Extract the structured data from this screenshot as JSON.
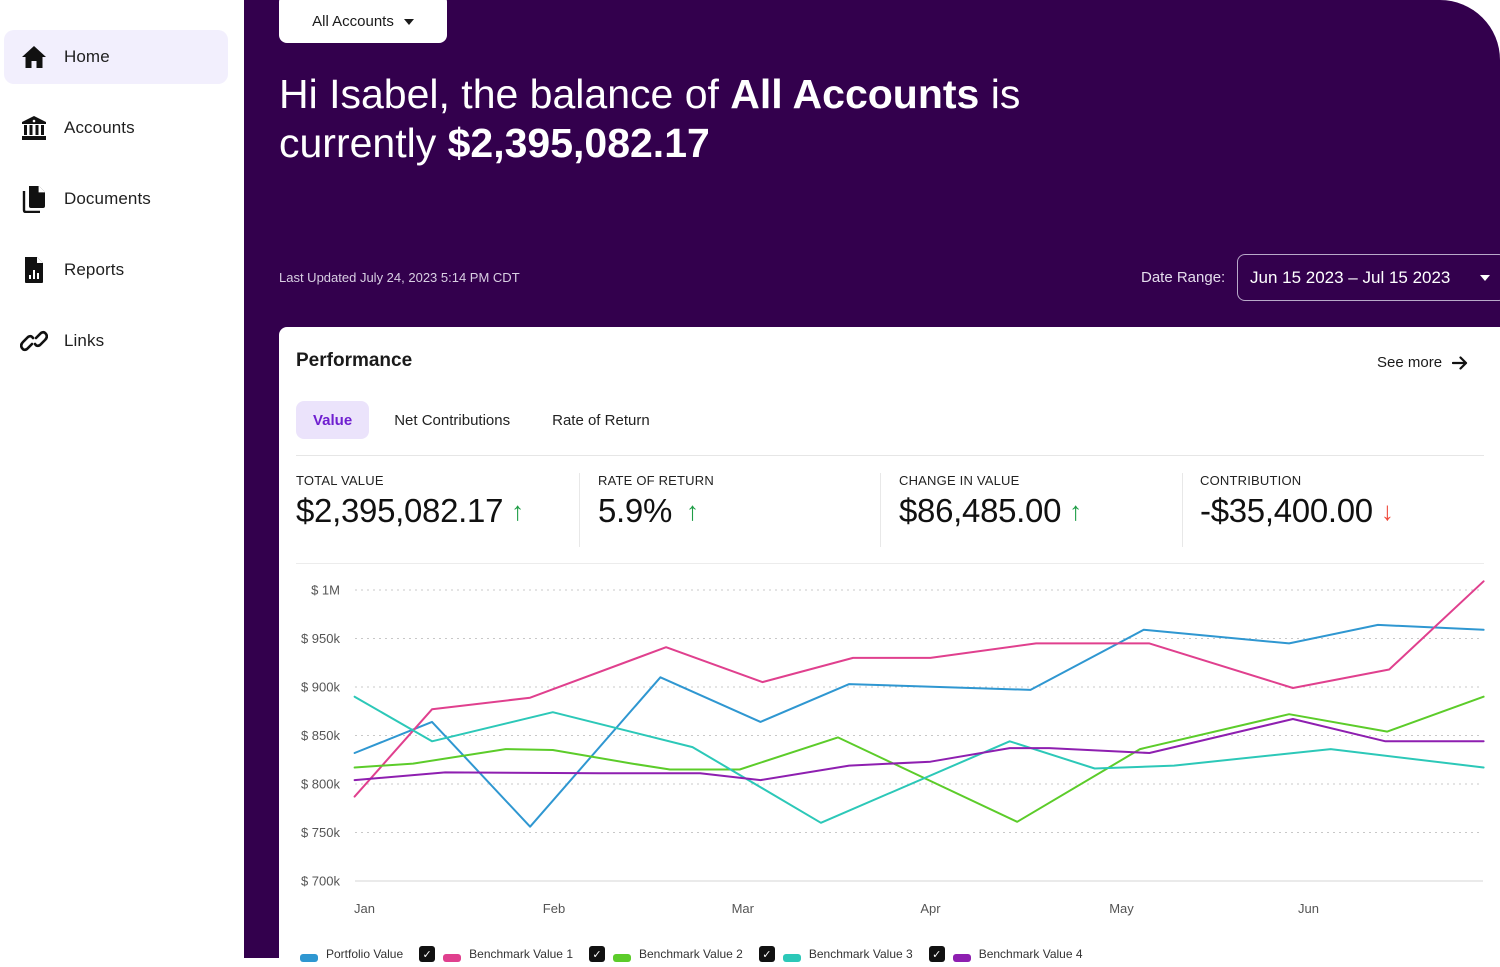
{
  "sidebar": {
    "items": [
      {
        "label": "Home",
        "icon": "home-icon",
        "active": true
      },
      {
        "label": "Accounts",
        "icon": "bank-icon",
        "active": false
      },
      {
        "label": "Documents",
        "icon": "documents-icon",
        "active": false
      },
      {
        "label": "Reports",
        "icon": "report-icon",
        "active": false
      },
      {
        "label": "Links",
        "icon": "link-icon",
        "active": false
      }
    ]
  },
  "header": {
    "account_selector": "All Accounts",
    "greeting_prefix": "Hi Isabel, the balance of ",
    "greeting_account": "All Accounts",
    "greeting_mid": " is currently ",
    "greeting_balance": "$2,395,082.17",
    "last_updated": "Last Updated July 24, 2023 5:14 PM CDT",
    "date_range_label": "Date Range:",
    "date_range_value": "Jun 15 2023 – Jul 15 2023"
  },
  "performance": {
    "title": "Performance",
    "see_more": "See more",
    "tabs": [
      {
        "label": "Value",
        "active": true
      },
      {
        "label": "Net Contributions",
        "active": false
      },
      {
        "label": "Rate of Return",
        "active": false
      }
    ],
    "stats": [
      {
        "label": "TOTAL VALUE",
        "value": "$2,395,082.17",
        "trend": "up"
      },
      {
        "label": "RATE OF RETURN",
        "value": "5.9%",
        "trend": "up"
      },
      {
        "label": "CHANGE IN VALUE",
        "value": "$86,485.00",
        "trend": "up"
      },
      {
        "label": "CONTRIBUTION",
        "value": "-$35,400.00",
        "trend": "down"
      }
    ]
  },
  "colors": {
    "hero_bg": "#33004d",
    "accent": "#6f1fd0",
    "up": "#1f9d46",
    "down": "#ef4b3c"
  },
  "chart_data": {
    "type": "line",
    "title": "",
    "xlabel": "",
    "ylabel": "",
    "x_ticks": [
      "Jan",
      "Feb",
      "Mar",
      "Apr",
      "May",
      "Jun"
    ],
    "x_range_months": [
      -0.05,
      5.93
    ],
    "y_ticks": [
      "$ 700k",
      "$ 750k",
      "$ 800k",
      "$ 850k",
      "$ 900k",
      "$ 950k",
      "$ 1M"
    ],
    "ylim": [
      700,
      1000
    ],
    "y_unit": "thousand USD",
    "grid": "horizontal-dotted",
    "legend_position": "bottom",
    "series": [
      {
        "name": "Portfolio Value",
        "color": "#2f97d1",
        "checkbox": false,
        "points": [
          [
            -0.05,
            832
          ],
          [
            0.36,
            864
          ],
          [
            0.88,
            756
          ],
          [
            1.57,
            910
          ],
          [
            2.1,
            864
          ],
          [
            2.57,
            903
          ],
          [
            3.53,
            897
          ],
          [
            4.13,
            959
          ],
          [
            4.9,
            945
          ],
          [
            5.37,
            964
          ],
          [
            5.93,
            959
          ]
        ]
      },
      {
        "name": "Benchmark Value 1",
        "color": "#e0408e",
        "checkbox": true,
        "points": [
          [
            -0.05,
            787
          ],
          [
            0.36,
            877
          ],
          [
            0.88,
            889
          ],
          [
            1.6,
            941
          ],
          [
            2.11,
            905
          ],
          [
            2.59,
            930
          ],
          [
            3.0,
            930
          ],
          [
            3.56,
            945
          ],
          [
            4.16,
            945
          ],
          [
            4.92,
            899
          ],
          [
            5.43,
            918
          ],
          [
            5.93,
            1009
          ]
        ]
      },
      {
        "name": "Benchmark Value 2",
        "color": "#5ccc2a",
        "checkbox": true,
        "points": [
          [
            -0.05,
            817
          ],
          [
            0.26,
            821
          ],
          [
            0.75,
            836
          ],
          [
            1.0,
            835
          ],
          [
            1.42,
            821
          ],
          [
            1.62,
            815
          ],
          [
            1.99,
            815
          ],
          [
            2.51,
            848
          ],
          [
            3.46,
            761
          ],
          [
            4.11,
            836
          ],
          [
            4.9,
            872
          ],
          [
            5.42,
            854
          ],
          [
            5.93,
            890
          ]
        ]
      },
      {
        "name": "Benchmark Value 3",
        "color": "#2cc8b8",
        "checkbox": true,
        "points": [
          [
            -0.05,
            890
          ],
          [
            0.36,
            844
          ],
          [
            1.0,
            874
          ],
          [
            1.74,
            838
          ],
          [
            2.42,
            760
          ],
          [
            3.42,
            844
          ],
          [
            3.87,
            816
          ],
          [
            4.29,
            819
          ],
          [
            5.12,
            836
          ],
          [
            5.93,
            817
          ]
        ]
      },
      {
        "name": "Benchmark Value 4",
        "color": "#8e1fb0",
        "checkbox": true,
        "points": [
          [
            -0.05,
            804
          ],
          [
            0.43,
            812
          ],
          [
            1.25,
            811
          ],
          [
            1.78,
            811
          ],
          [
            2.1,
            804
          ],
          [
            2.57,
            819
          ],
          [
            3.0,
            823
          ],
          [
            3.42,
            837
          ],
          [
            3.63,
            837
          ],
          [
            4.16,
            832
          ],
          [
            4.92,
            867
          ],
          [
            5.41,
            844
          ],
          [
            5.93,
            844
          ]
        ]
      }
    ]
  }
}
